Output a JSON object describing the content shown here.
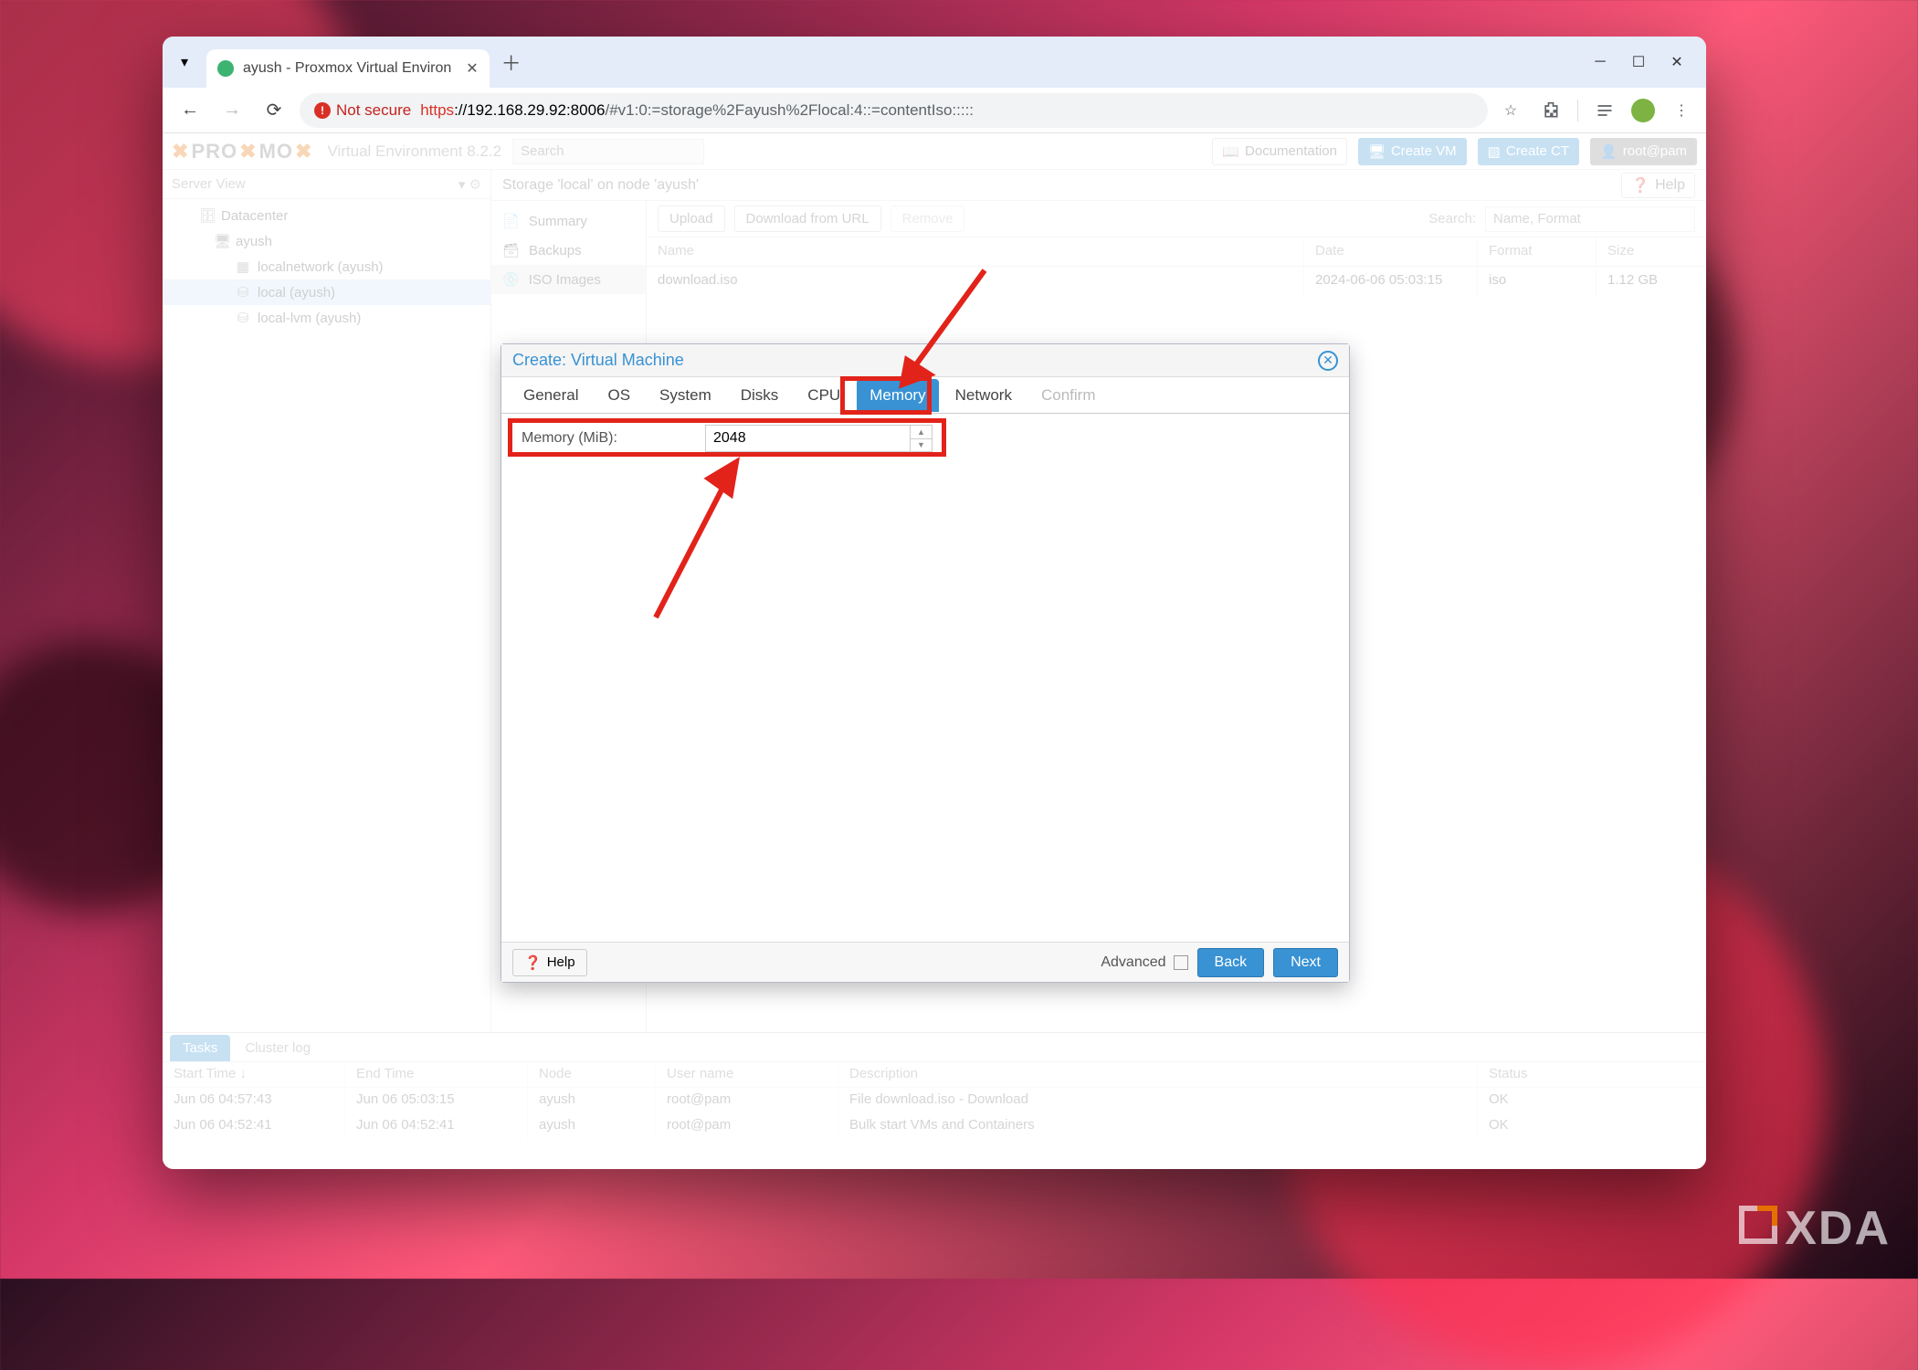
{
  "browser": {
    "tab_title": "ayush - Proxmox Virtual Environ",
    "security_label": "Not secure",
    "url_prefix": "https",
    "url_host": "://192.168.29.92:8006",
    "url_rest": "/#v1:0:=storage%2Fayush%2Flocal:4::=contentIso:::::"
  },
  "pve": {
    "logo_pro": "PRO",
    "logo_mo": "MO",
    "version": "Virtual Environment 8.2.2",
    "search_placeholder": "Search",
    "buttons": {
      "docs": "Documentation",
      "create_vm": "Create VM",
      "create_ct": "Create CT",
      "user": "root@pam"
    },
    "view": "Server View",
    "tree": {
      "datacenter": "Datacenter",
      "node": "ayush",
      "items": [
        "localnetwork (ayush)",
        "local (ayush)",
        "local-lvm (ayush)"
      ]
    },
    "crumb": "Storage 'local' on node 'ayush'",
    "help": "Help",
    "subnav": [
      "Summary",
      "Backups",
      "ISO Images"
    ],
    "toolbar": {
      "upload": "Upload",
      "download": "Download from URL",
      "remove": "Remove",
      "search_label": "Search:",
      "search_placeholder": "Name, Format"
    },
    "grid": {
      "headers": {
        "name": "Name",
        "date": "Date",
        "format": "Format",
        "size": "Size"
      },
      "rows": [
        {
          "name": "download.iso",
          "date": "2024-06-06 05:03:15",
          "format": "iso",
          "size": "1.12 GB"
        }
      ]
    },
    "log": {
      "tabs": [
        "Tasks",
        "Cluster log"
      ],
      "headers": {
        "start": "Start Time ↓",
        "end": "End Time",
        "node": "Node",
        "user": "User name",
        "desc": "Description",
        "status": "Status"
      },
      "rows": [
        {
          "start": "Jun 06 04:57:43",
          "end": "Jun 06 05:03:15",
          "node": "ayush",
          "user": "root@pam",
          "desc": "File download.iso - Download",
          "status": "OK"
        },
        {
          "start": "Jun 06 04:52:41",
          "end": "Jun 06 04:52:41",
          "node": "ayush",
          "user": "root@pam",
          "desc": "Bulk start VMs and Containers",
          "status": "OK"
        }
      ]
    }
  },
  "modal": {
    "title": "Create: Virtual Machine",
    "tabs": [
      "General",
      "OS",
      "System",
      "Disks",
      "CPU",
      "Memory",
      "Network",
      "Confirm"
    ],
    "active_tab": "Memory",
    "memory_label": "Memory (MiB):",
    "memory_value": "2048",
    "footer": {
      "help": "Help",
      "advanced": "Advanced",
      "back": "Back",
      "next": "Next"
    }
  },
  "watermark": "XDA"
}
